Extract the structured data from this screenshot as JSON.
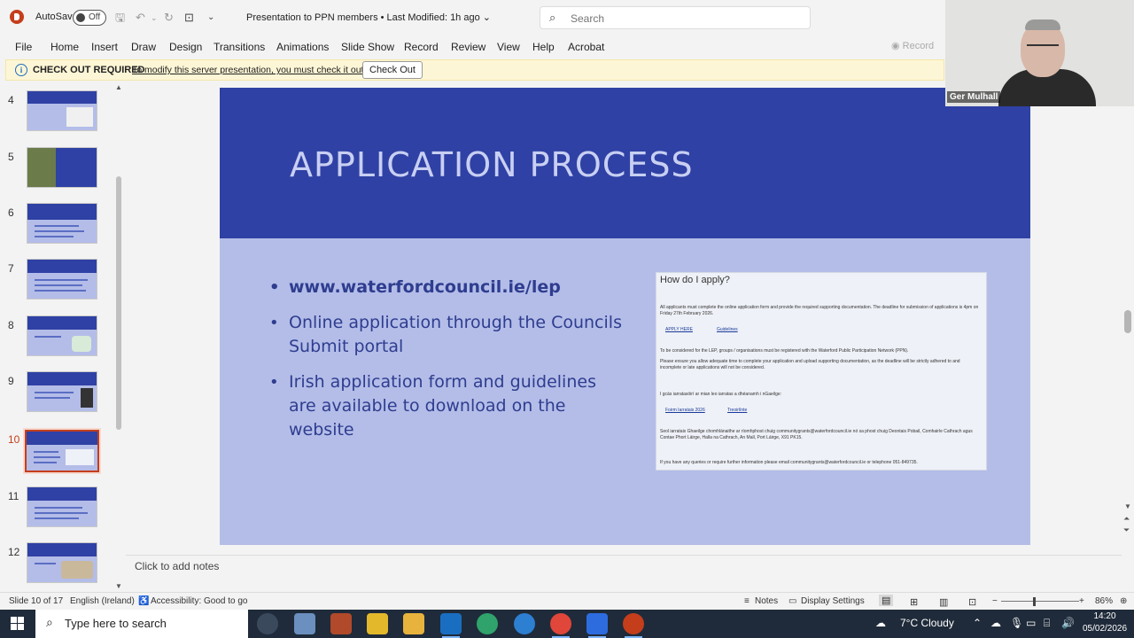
{
  "titlebar": {
    "autosave_label": "AutoSave",
    "autosave_state": "Off",
    "doc_title": "Presentation to PPN members • Last Modified: 1h ago ⌄",
    "search_placeholder": "Search"
  },
  "menu": {
    "items": [
      "File",
      "Home",
      "Insert",
      "Draw",
      "Design",
      "Transitions",
      "Animations",
      "Slide Show",
      "Record",
      "Review",
      "View",
      "Help",
      "Acrobat"
    ],
    "record_button": "Record"
  },
  "infobar": {
    "title": "CHECK OUT REQUIRED",
    "message": "To modify this server presentation, you must check it out.",
    "button": "Check Out"
  },
  "thumbnails": {
    "numbers": [
      "4",
      "5",
      "6",
      "7",
      "8",
      "9",
      "10",
      "11",
      "12"
    ],
    "active": "10"
  },
  "slide": {
    "title": "APPLICATION PROCESS",
    "bullets": [
      "www.waterfordcouncil.ie/lep",
      "Online application through the Councils Submit portal",
      "Irish application form and guidelines are available to download on the website"
    ],
    "card": {
      "heading": "How do I apply?",
      "para1": "All applicants must complete the online application form and provide the required supporting documentation. The deadline for submission of applications is 4pm on Friday 27th February 2026.",
      "link_apply": "APPLY HERE",
      "link_guidelines": "Guidelines",
      "para2": "To be considered for the LEP, groups / organisations must be registered with the Waterford Public Participation Network (PPN).",
      "para3": "Please ensure you allow adequate time to complete your application and upload supporting documentation, as the deadline will be strictly adhered to and incomplete or late applications will not be considered.",
      "para4": "I gcás iarratasóirí ar mian leo iarratas a dhéanamh i nGaeilge:",
      "link_irish_form": "Foirm Iarratais 2026",
      "link_irish_guide": "Treoirlínte",
      "para5": "Seol iarratais Ghaeilge chomhlánaithe ar ríomhphost chuig communitygrants@waterfordcouncil.ie nó sa phost chuig Deontais Pobail, Comhairle Cathrach agus Contae Phort Láirge, Halla na Cathrach, An Mall, Port Láirge, X91 PK15.",
      "para6": "If you have any queries or require further information please email communitygrants@waterfordcouncil.ie or telephone 051-849735."
    }
  },
  "webcam": {
    "name": "Ger Mulhall"
  },
  "notes": {
    "placeholder": "Click to add notes"
  },
  "status": {
    "slide_info": "Slide 10 of 17",
    "language": "English (Ireland)",
    "accessibility": "Accessibility: Good to go",
    "notes": "Notes",
    "display_settings": "Display Settings",
    "zoom_level": "86%"
  },
  "taskbar": {
    "search_placeholder": "Type here to search",
    "weather": "7°C  Cloudy",
    "time": "14:20",
    "date": "05/02/2026"
  },
  "colors": {
    "accent": "#c43e1c",
    "slide_header": "#2f41a4",
    "slide_body": "#b4bde8",
    "bullet_text": "#2e3d8f"
  }
}
